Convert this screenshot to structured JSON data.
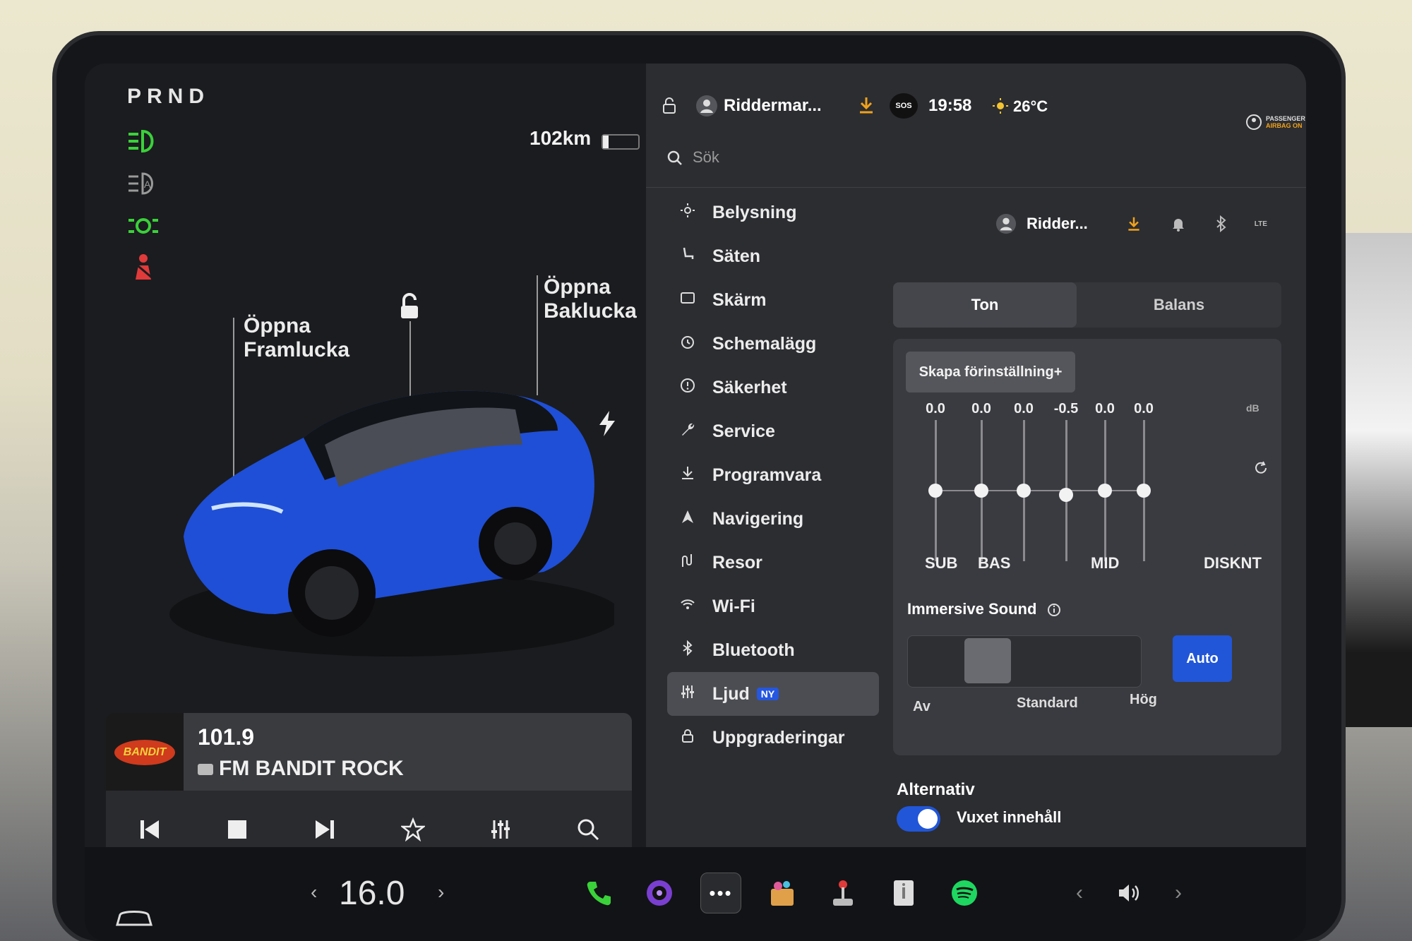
{
  "left": {
    "gear": "PRND",
    "range": "102km",
    "door_labels": {
      "front": [
        "Öppna",
        "Framlucka"
      ],
      "rear": [
        "Öppna",
        "Baklucka"
      ]
    }
  },
  "media": {
    "frequency": "101.9",
    "station": "FM BANDIT ROCK",
    "logo_text": "BANDIT"
  },
  "status": {
    "profile_top": "Riddermar...",
    "time": "19:58",
    "temperature": "26°C",
    "sos": "SOS",
    "airbag": [
      "PASSENGER",
      "AIRBAG ON"
    ],
    "profile_small": "Ridder...",
    "lte": "LTE"
  },
  "search": {
    "placeholder": "Sök"
  },
  "menu": [
    {
      "label": "Belysning",
      "icon": "sun-icon"
    },
    {
      "label": "Säten",
      "icon": "seat-icon"
    },
    {
      "label": "Skärm",
      "icon": "display-icon"
    },
    {
      "label": "Schemalägg",
      "icon": "clock-icon"
    },
    {
      "label": "Säkerhet",
      "icon": "alert-icon"
    },
    {
      "label": "Service",
      "icon": "wrench-icon"
    },
    {
      "label": "Programvara",
      "icon": "download-icon"
    },
    {
      "label": "Navigering",
      "icon": "navigation-icon"
    },
    {
      "label": "Resor",
      "icon": "trips-icon"
    },
    {
      "label": "Wi-Fi",
      "icon": "wifi-icon"
    },
    {
      "label": "Bluetooth",
      "icon": "bluetooth-icon"
    },
    {
      "label": "Ljud",
      "icon": "equalizer-icon",
      "badge": "NY",
      "active": true
    },
    {
      "label": "Uppgraderingar",
      "icon": "lock-icon"
    }
  ],
  "audio": {
    "tabs": [
      "Ton",
      "Balans"
    ],
    "preset_button": "Skapa förinställning+",
    "eq_values": [
      "0.0",
      "0.0",
      "0.0",
      "-0.5",
      "0.0",
      "0.0"
    ],
    "eq_unit": "dB",
    "eq_labels": [
      "SUB",
      "BAS",
      "MID",
      "DISKNT"
    ],
    "immersive_title": "Immersive Sound",
    "immersive_auto": "Auto",
    "immersive_labels": [
      "Av",
      "Standard",
      "Hög"
    ],
    "alternatives_title": "Alternativ",
    "adult_content": "Vuxet innehåll"
  },
  "climate": {
    "temperature": "16.0"
  },
  "colors": {
    "accent": "#2156d8",
    "green": "#3ad13a",
    "red": "#e03a3a"
  }
}
